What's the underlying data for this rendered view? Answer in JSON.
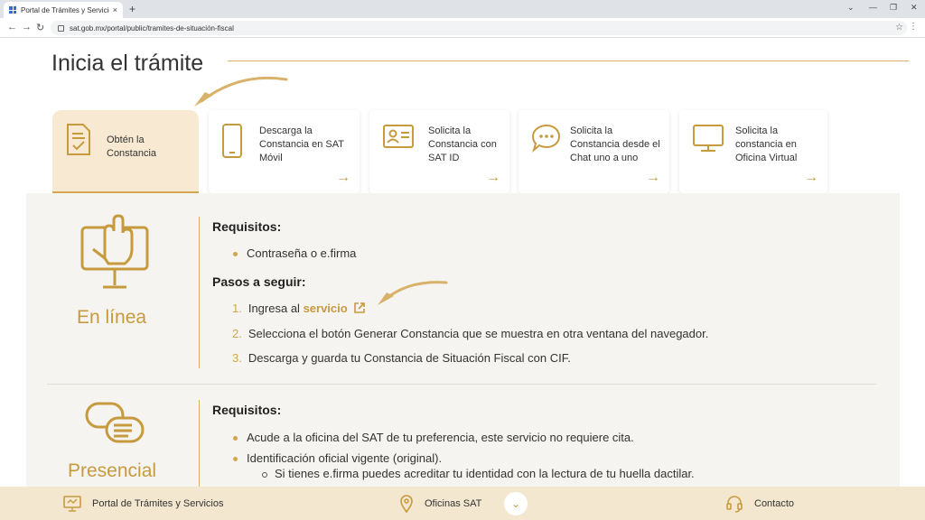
{
  "browser": {
    "tab_title": "Portal de Trámites y Servicios S",
    "tab_close": "×",
    "new_tab": "+",
    "url": "sat.gob.mx/portal/public/tramites-de-situación-fiscal"
  },
  "page": {
    "title": "Inicia el trámite"
  },
  "cards": [
    {
      "label": "Obtén la Constancia",
      "icon": "document-check-icon"
    },
    {
      "label": "Descarga la Constancia en SAT Móvil",
      "icon": "smartphone-icon",
      "arrow": "→"
    },
    {
      "label": "Solicita la Constancia con SAT ID",
      "icon": "id-card-icon",
      "arrow": "→"
    },
    {
      "label": "Solicita la Constancia desde el Chat uno a uno",
      "icon": "chat-bubble-icon",
      "arrow": "→"
    },
    {
      "label": "Solicita la constancia en Oficina Virtual",
      "icon": "monitor-icon",
      "arrow": "→"
    }
  ],
  "online": {
    "mode_label": "En línea",
    "requirements_heading": "Requisitos:",
    "requirements": [
      "Contraseña o e.firma"
    ],
    "steps_heading": "Pasos a seguir:",
    "step1_num": "1.",
    "step1_text": "Ingresa al",
    "step1_link": "servicio",
    "step2_num": "2.",
    "step2_text": "Selecciona el botón Generar Constancia que se muestra en otra ventana del navegador.",
    "step3_num": "3.",
    "step3_text": "Descarga y guarda tu Constancia de Situación Fiscal con CIF."
  },
  "presencial": {
    "mode_label": "Presencial",
    "requirements_heading": "Requisitos:",
    "req1": "Acude a la oficina del SAT de tu preferencia, este servicio no requiere cita.",
    "req2": "Identificación oficial vigente (original).",
    "req2_sub": "Si tienes e.firma puedes acreditar tu identidad con la lectura de tu huella dactilar."
  },
  "footer": {
    "portal": "Portal de Trámites y Servicios",
    "offices": "Oficinas SAT",
    "contact": "Contacto",
    "toggle": "⌄"
  },
  "colors": {
    "accent": "#c79a3e",
    "active_card_bg": "#f8ead2",
    "footer_bg": "#f3e7cf"
  }
}
